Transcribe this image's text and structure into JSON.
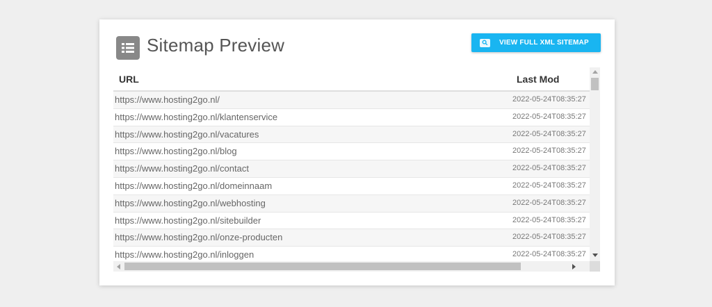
{
  "header": {
    "title": "Sitemap Preview",
    "icon": "sitemap-list-icon",
    "icon_color": "#888888"
  },
  "xml_button": {
    "label": "VIEW FULL XML SITEMAP",
    "icon": "search-icon",
    "color": "#19b5f1"
  },
  "table": {
    "columns": [
      "URL",
      "Last Mod"
    ],
    "rows": [
      {
        "url": "https://www.hosting2go.nl/",
        "lastmod": "2022-05-24T08:35:27"
      },
      {
        "url": "https://www.hosting2go.nl/klantenservice",
        "lastmod": "2022-05-24T08:35:27"
      },
      {
        "url": "https://www.hosting2go.nl/vacatures",
        "lastmod": "2022-05-24T08:35:27"
      },
      {
        "url": "https://www.hosting2go.nl/blog",
        "lastmod": "2022-05-24T08:35:27"
      },
      {
        "url": "https://www.hosting2go.nl/contact",
        "lastmod": "2022-05-24T08:35:27"
      },
      {
        "url": "https://www.hosting2go.nl/domeinnaam",
        "lastmod": "2022-05-24T08:35:27"
      },
      {
        "url": "https://www.hosting2go.nl/webhosting",
        "lastmod": "2022-05-24T08:35:27"
      },
      {
        "url": "https://www.hosting2go.nl/sitebuilder",
        "lastmod": "2022-05-24T08:35:27"
      },
      {
        "url": "https://www.hosting2go.nl/onze-producten",
        "lastmod": "2022-05-24T08:35:27"
      },
      {
        "url": "https://www.hosting2go.nl/inloggen",
        "lastmod": "2022-05-24T08:35:27"
      }
    ]
  }
}
